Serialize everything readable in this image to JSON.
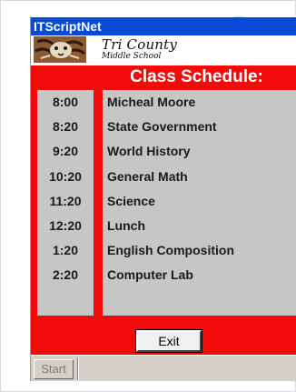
{
  "window": {
    "title": "ITScriptNet"
  },
  "banner": {
    "logo_icon": "tiger-logo",
    "school_name": "Tri County",
    "school_sub": "Middle School"
  },
  "schedule": {
    "heading": "Class Schedule:",
    "rows": [
      {
        "time": "8:00",
        "class": "Micheal Moore"
      },
      {
        "time": "8:20",
        "class": "State Government"
      },
      {
        "time": "9:20",
        "class": "World History"
      },
      {
        "time": "10:20",
        "class": "General Math"
      },
      {
        "time": "11:20",
        "class": "Science"
      },
      {
        "time": "12:20",
        "class": "Lunch"
      },
      {
        "time": "1:20",
        "class": "English Composition"
      },
      {
        "time": "2:20",
        "class": "Computer Lab"
      }
    ]
  },
  "buttons": {
    "exit_label": "Exit"
  },
  "taskbar": {
    "start_label": "Start"
  },
  "colors": {
    "titlebar": "#0a49d6",
    "app_background": "#f10b0b",
    "panel": "#c6c6c6"
  }
}
